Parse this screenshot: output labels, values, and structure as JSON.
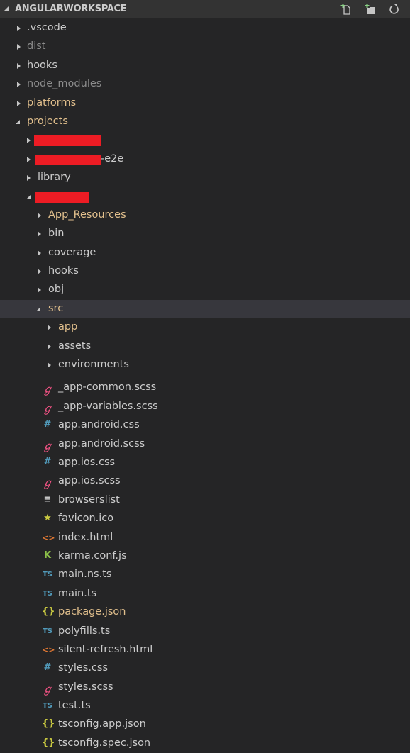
{
  "explorer": {
    "title": "ANGULARWORKSPACE",
    "actions": [
      {
        "name": "new-file-button",
        "icon": "new-file-icon"
      },
      {
        "name": "new-folder-button",
        "icon": "new-folder-icon"
      },
      {
        "name": "refresh-button",
        "icon": "refresh-icon"
      }
    ]
  },
  "colors": {
    "background": "#252526",
    "header": "#333333",
    "selected_row": "#37373d",
    "text": "#cccccc",
    "ignored_text": "#8c8c8c",
    "modified_text": "#e2c08d",
    "redaction": "#ed1c24",
    "scss_icon": "#f55385",
    "css_icon": "#519aba",
    "ts_icon": "#519aba",
    "json_icon": "#cbcb41",
    "html_icon": "#e37933",
    "karma_icon": "#8dc149",
    "favicon_icon": "#cbcb41"
  },
  "tree": {
    "root_folders": [
      {
        "label": ".vscode",
        "state": "collapsed",
        "style": "normal"
      },
      {
        "label": "dist",
        "state": "collapsed",
        "style": "ignored"
      },
      {
        "label": "hooks",
        "state": "collapsed",
        "style": "normal"
      },
      {
        "label": "node_modules",
        "state": "collapsed",
        "style": "ignored"
      },
      {
        "label": "platforms",
        "state": "collapsed",
        "style": "modified"
      },
      {
        "label": "projects",
        "state": "expanded",
        "style": "modified"
      }
    ],
    "projects_children": [
      {
        "label": "[redacted]",
        "state": "collapsed",
        "redacted": true
      },
      {
        "label": "-e2e",
        "state": "collapsed",
        "redacted": true
      },
      {
        "label": "library",
        "state": "collapsed"
      },
      {
        "label": "[redacted]",
        "state": "expanded",
        "redacted": true
      }
    ],
    "project_children": [
      {
        "label": "App_Resources",
        "state": "collapsed",
        "style": "modified"
      },
      {
        "label": "bin",
        "state": "collapsed",
        "style": "normal"
      },
      {
        "label": "coverage",
        "state": "collapsed",
        "style": "normal"
      },
      {
        "label": "hooks",
        "state": "collapsed",
        "style": "normal"
      },
      {
        "label": "obj",
        "state": "collapsed",
        "style": "normal"
      },
      {
        "label": "src",
        "state": "expanded",
        "style": "modified",
        "selected": true
      }
    ],
    "src_folders": [
      {
        "label": "app",
        "style": "modified"
      },
      {
        "label": "assets",
        "style": "normal"
      },
      {
        "label": "environments",
        "style": "normal"
      }
    ],
    "src_files": [
      {
        "label": "_app-common.scss",
        "icon": "sass-icon",
        "glyph": "ℊ"
      },
      {
        "label": "_app-variables.scss",
        "icon": "sass-icon",
        "glyph": "ℊ"
      },
      {
        "label": "app.android.css",
        "icon": "css-icon",
        "glyph": "#"
      },
      {
        "label": "app.android.scss",
        "icon": "sass-icon",
        "glyph": "ℊ"
      },
      {
        "label": "app.ios.css",
        "icon": "css-icon",
        "glyph": "#"
      },
      {
        "label": "app.ios.scss",
        "icon": "sass-icon",
        "glyph": "ℊ"
      },
      {
        "label": "browserslist",
        "icon": "text-file-icon",
        "glyph": "≡"
      },
      {
        "label": "favicon.ico",
        "icon": "star-icon",
        "glyph": "★"
      },
      {
        "label": "index.html",
        "icon": "html-icon",
        "glyph": "<>"
      },
      {
        "label": "karma.conf.js",
        "icon": "karma-icon",
        "glyph": "K"
      },
      {
        "label": "main.ns.ts",
        "icon": "typescript-icon",
        "glyph": "TS"
      },
      {
        "label": "main.ts",
        "icon": "typescript-icon",
        "glyph": "TS"
      },
      {
        "label": "package.json",
        "icon": "json-icon",
        "glyph": "{}",
        "style": "modified"
      },
      {
        "label": "polyfills.ts",
        "icon": "typescript-icon",
        "glyph": "TS"
      },
      {
        "label": "silent-refresh.html",
        "icon": "html-icon",
        "glyph": "<>"
      },
      {
        "label": "styles.css",
        "icon": "css-icon",
        "glyph": "#"
      },
      {
        "label": "styles.scss",
        "icon": "sass-icon",
        "glyph": "ℊ"
      },
      {
        "label": "test.ts",
        "icon": "typescript-icon",
        "glyph": "TS"
      },
      {
        "label": "tsconfig.app.json",
        "icon": "json-icon",
        "glyph": "{}"
      },
      {
        "label": "tsconfig.spec.json",
        "icon": "json-icon",
        "glyph": "{}"
      }
    ]
  }
}
